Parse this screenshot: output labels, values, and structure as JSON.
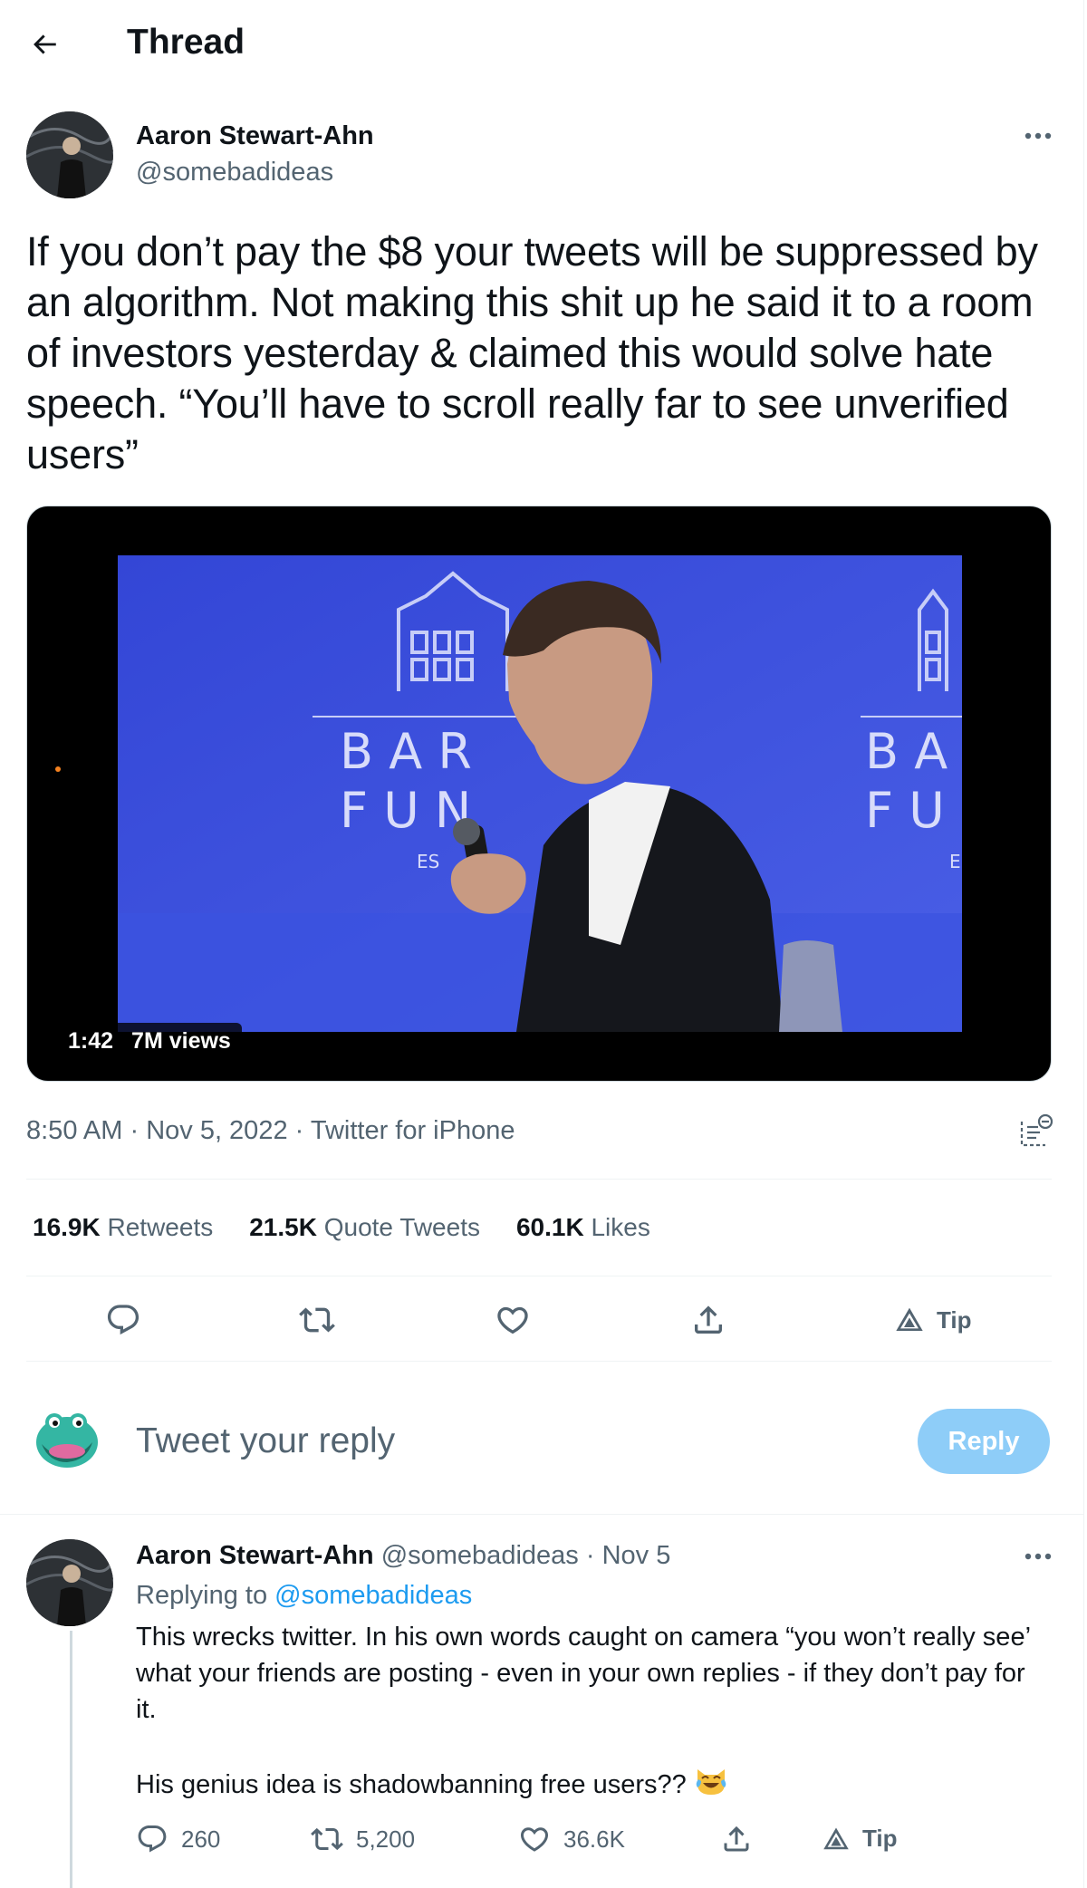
{
  "header": {
    "title": "Thread"
  },
  "tweet": {
    "author_name": "Aaron Stewart-Ahn",
    "author_handle": "@somebadideas",
    "text": "If you don’t pay the $8 your tweets will be suppressed by an algorithm. Not making this shit up he said it to a room of investors yesterday & claimed this would solve hate speech. “You’ll have to scroll really far to see unverified users”",
    "media": {
      "duration": "1:42",
      "views": "7M views",
      "backdrop_text_left": [
        "B A R",
        "F U N",
        "ES"
      ],
      "backdrop_text_right": [
        "B A",
        "F U",
        "E"
      ]
    },
    "time": "8:50 AM",
    "date": "Nov 5, 2022",
    "source": "Twitter for iPhone",
    "separator": " · ",
    "stats": [
      {
        "count": "16.9K",
        "label": "Retweets"
      },
      {
        "count": "21.5K",
        "label": "Quote Tweets"
      },
      {
        "count": "60.1K",
        "label": "Likes"
      }
    ],
    "actions": {
      "tip_label": "Tip"
    }
  },
  "composer": {
    "placeholder": "Tweet your reply",
    "button_label": "Reply"
  },
  "reply": {
    "author_name": "Aaron Stewart-Ahn",
    "author_handle": "@somebadideas",
    "separator": " · ",
    "date": "Nov 5",
    "replying_prefix": "Replying to ",
    "replying_to": "@somebadideas",
    "text": "This wrecks twitter. In his own words caught on camera “you won’t really see’ what your friends are posting - even in your own replies - if they don’t pay for it.\n\nHis genius idea is shadowbanning free users??",
    "emoji": "crying-laughing-cat-emoji",
    "actions": {
      "replies": "260",
      "retweets": "5,200",
      "likes": "36.6K",
      "tip_label": "Tip"
    }
  },
  "colors": {
    "accent": "#1d9bf0",
    "reply_button": "#8ecdf8",
    "muted": "#536471",
    "text": "#0f1419",
    "video_bg": "#3a4bd8"
  }
}
